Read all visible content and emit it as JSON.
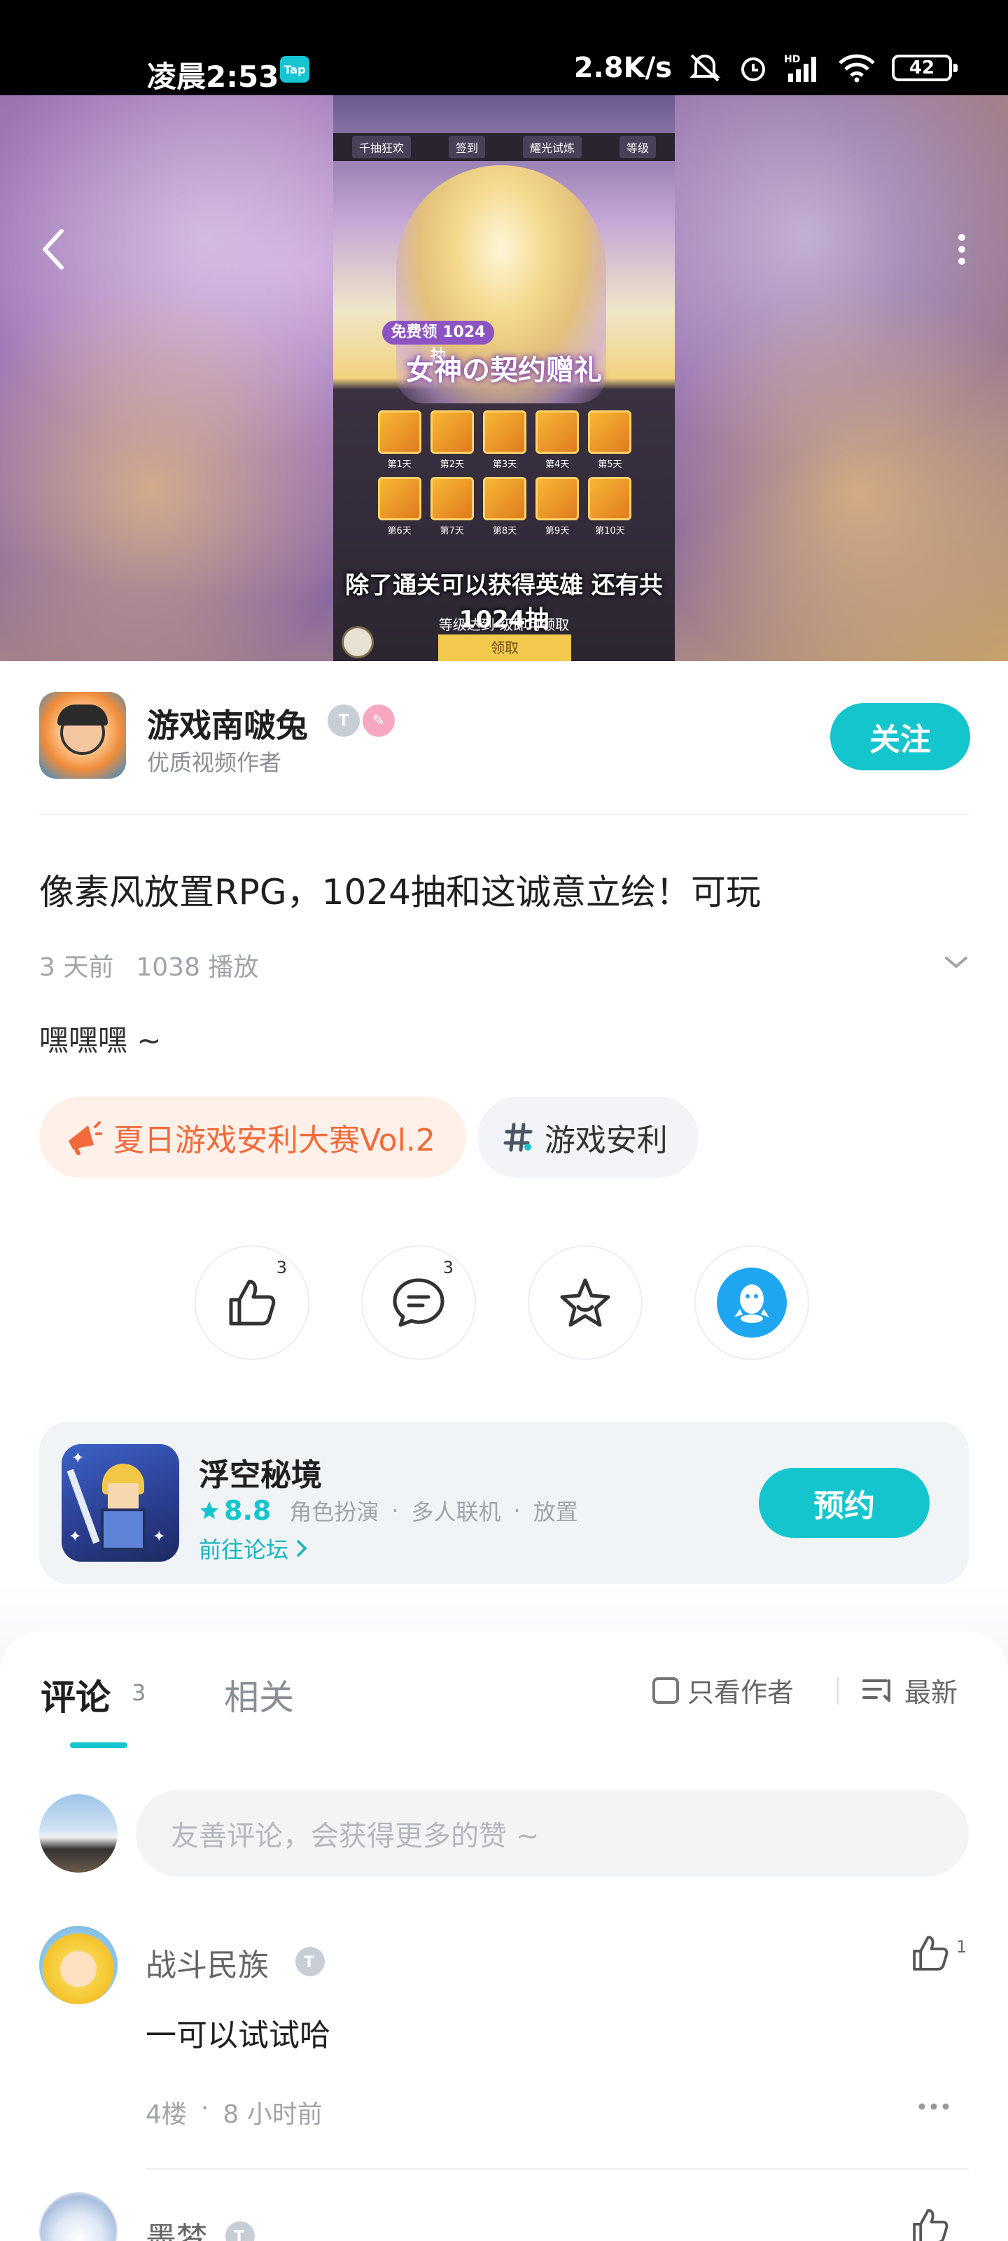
{
  "status_bar": {
    "time": "凌晨2:53",
    "app_badge": "Tap",
    "net_speed": "2.8K/s",
    "signal_label": "HD",
    "battery": "42"
  },
  "video": {
    "top_tabs": [
      "千抽狂欢",
      "签到",
      "耀光试炼",
      "等级"
    ],
    "promo_badge": "免费领 1024 抽",
    "banner_title": "女神の契约赠礼",
    "days": [
      "第1天",
      "第2天",
      "第3天",
      "第4天",
      "第5天",
      "第6天",
      "第7天",
      "第8天",
      "第9天",
      "第10天"
    ],
    "subtitle": "除了通关可以获得英雄 还有共1024抽",
    "level_hint": "等级达到  级即可领取",
    "claim_label": "领取"
  },
  "author": {
    "name": "游戏南啵兔",
    "subtitle": "优质视频作者",
    "badge_1": "T",
    "follow_label": "关注"
  },
  "post": {
    "title": "像素风放置RPG，1024抽和这诚意立绘！可玩",
    "time_ago": "3 天前",
    "plays": "1038 播放",
    "description": "嘿嘿嘿 ~",
    "tags": [
      {
        "label": "夏日游戏安利大赛Vol.2",
        "icon": "megaphone-icon",
        "color": "#f26a3a"
      },
      {
        "label": "游戏安利",
        "icon": "hashtag-icon",
        "color": "#333333"
      }
    ]
  },
  "actions": {
    "like_count": "3",
    "comment_count": "3"
  },
  "game": {
    "name": "浮空秘境",
    "rating": "8.8",
    "genres": [
      "角色扮演",
      "多人联机",
      "放置"
    ],
    "genre_separator": "·",
    "forum_link": "前往论坛",
    "reserve_label": "预约"
  },
  "comments": {
    "tab_comments": "评论",
    "tab_count": "3",
    "tab_related": "相关",
    "only_author": "只看作者",
    "sort_label": "最新",
    "input_placeholder": "友善评论，会获得更多的赞 ~",
    "items": [
      {
        "name": "战斗民族",
        "text": "一可以试试哈",
        "floor": "4楼",
        "sep": "·",
        "time": "8 小时前",
        "likes": "1"
      },
      {
        "name": "墨梦"
      }
    ]
  },
  "colors": {
    "accent": "#15c5ce",
    "tag_orange": "#f26a3a"
  }
}
